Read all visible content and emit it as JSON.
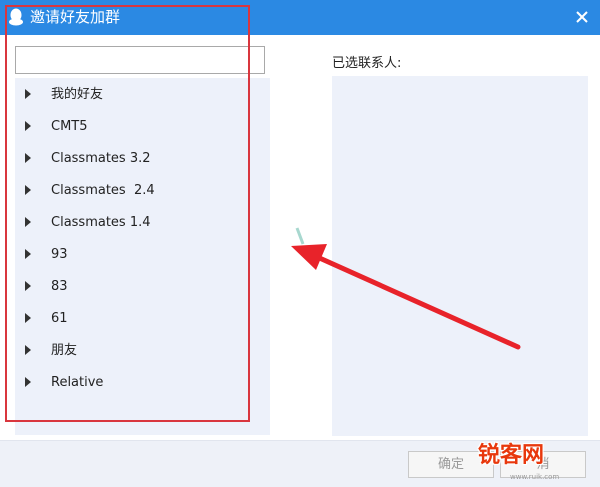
{
  "window": {
    "title": "邀请好友加群"
  },
  "search": {
    "value": "",
    "placeholder": ""
  },
  "friend_tree": {
    "groups": [
      {
        "label": "我的好友"
      },
      {
        "label": "CMT5"
      },
      {
        "label": "Classmates 3.2"
      },
      {
        "label": "Classmates  2.4"
      },
      {
        "label": "Classmates 1.4"
      },
      {
        "label": "93"
      },
      {
        "label": "83"
      },
      {
        "label": "61"
      },
      {
        "label": "朋友"
      },
      {
        "label": "Relative"
      }
    ]
  },
  "selected": {
    "label": "已选联系人:"
  },
  "footer": {
    "ok_label": "确定",
    "cancel_label": "消"
  },
  "watermark": {
    "brand": "锐客网",
    "url": "www.ruik.com"
  },
  "colors": {
    "titlebar": "#2b89e3",
    "panel": "#edf1fa",
    "annotation": "#d9363e"
  }
}
